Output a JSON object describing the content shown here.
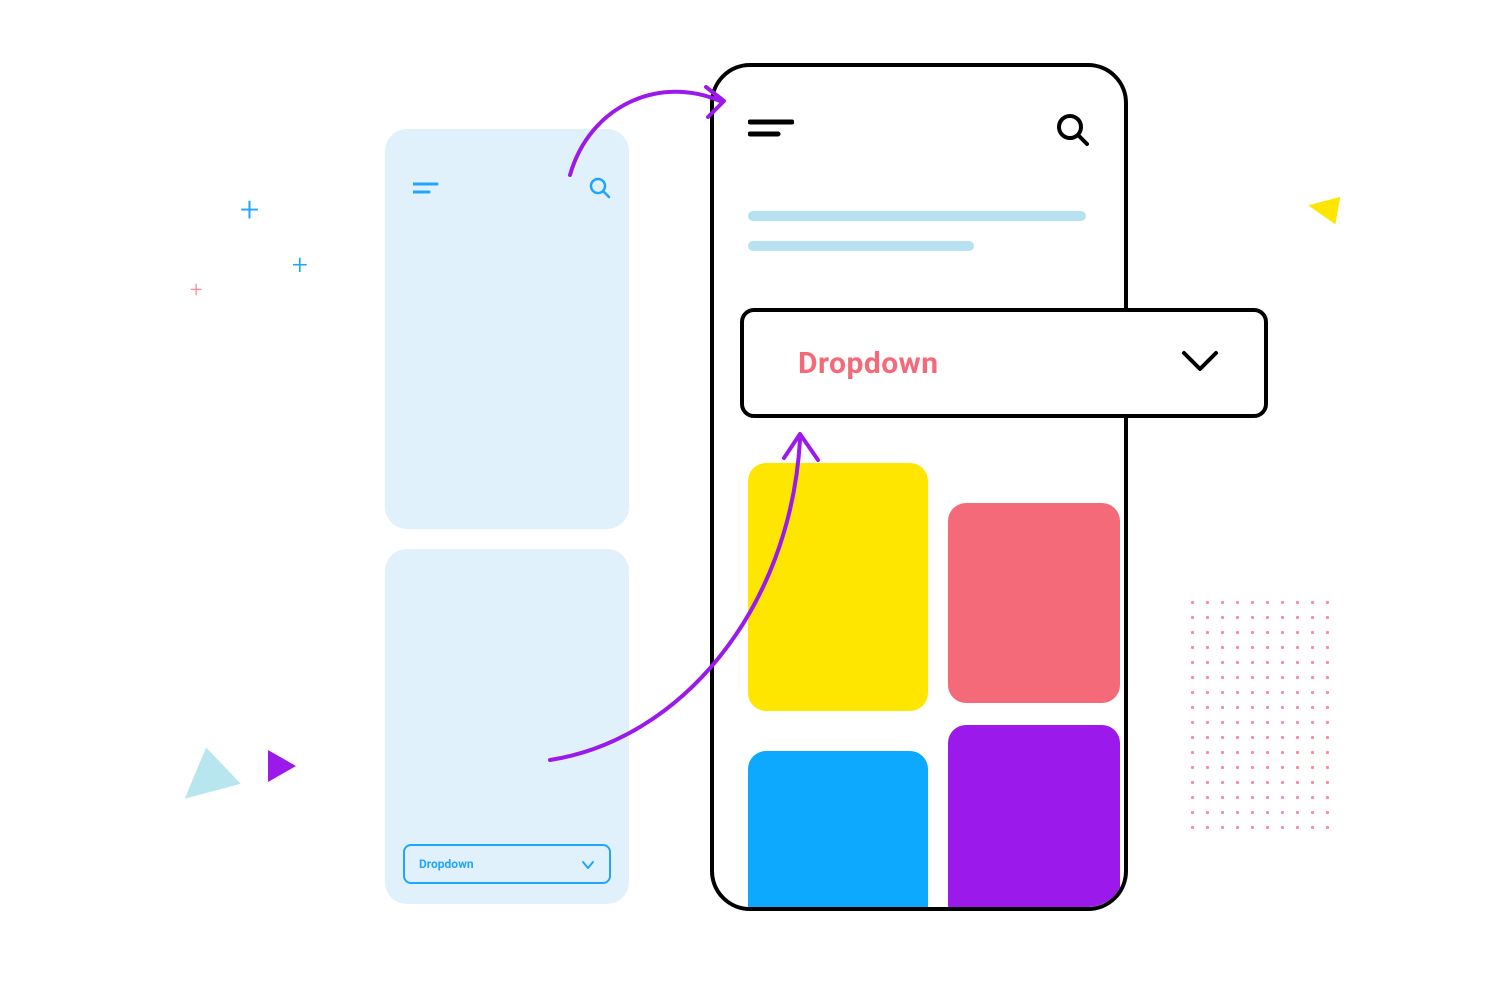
{
  "mini": {
    "dropdown_label": "Dropdown"
  },
  "big": {
    "dropdown_label": "Dropdown"
  },
  "colors": {
    "accent_blue": "#1FA4FF",
    "accent_pink": "#F46A78",
    "accent_yellow": "#FFE600",
    "accent_purple": "#9B19EB",
    "sky": "#E0F1FB",
    "line": "#B6E1F0"
  }
}
